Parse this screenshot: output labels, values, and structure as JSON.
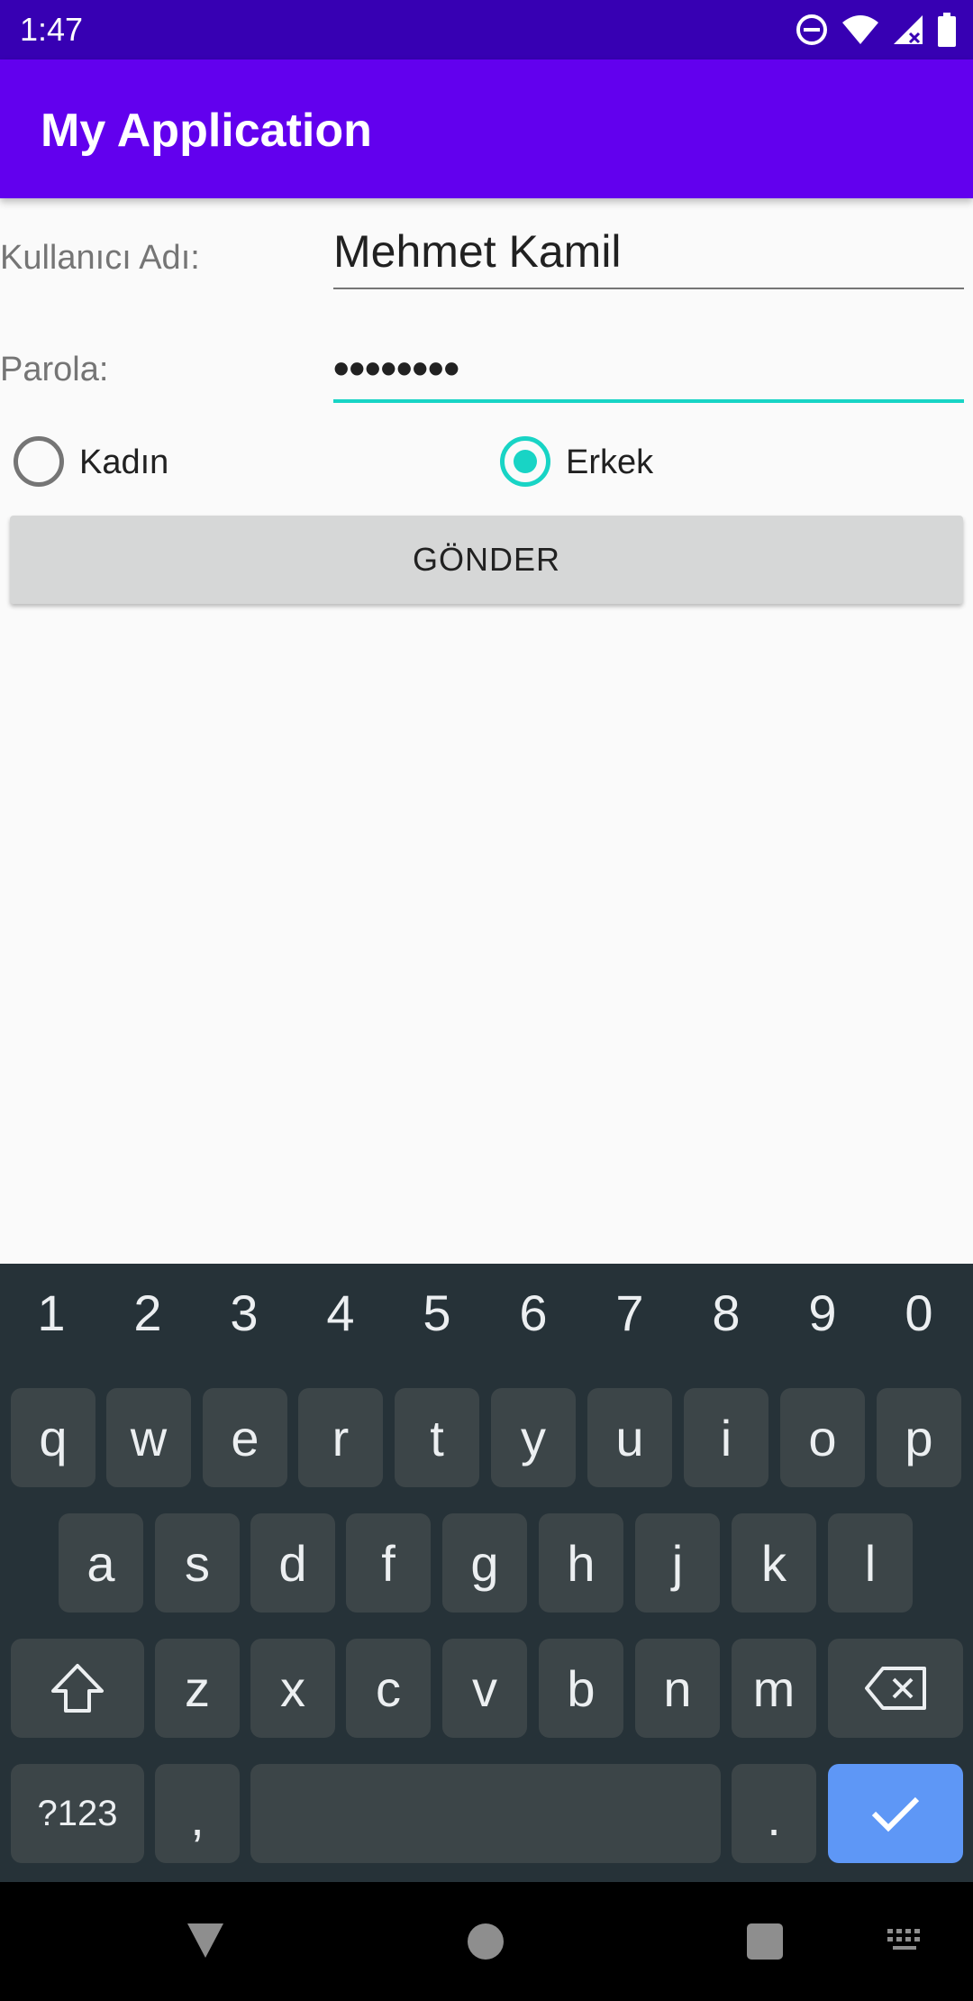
{
  "status_bar": {
    "time": "1:47",
    "icons": [
      "do-not-disturb-icon",
      "wifi-icon",
      "cellular-signal-icon",
      "battery-icon"
    ]
  },
  "app_bar": {
    "title": "My Application"
  },
  "form": {
    "username_label": "Kullanıcı Adı:",
    "username_value": "Mehmet Kamil",
    "password_label": "Parola:",
    "password_value": "••••••••",
    "gender_options": [
      {
        "label": "Kadın",
        "checked": false
      },
      {
        "label": "Erkek",
        "checked": true
      }
    ],
    "submit_label": "GÖNDER"
  },
  "keyboard": {
    "number_row": [
      "1",
      "2",
      "3",
      "4",
      "5",
      "6",
      "7",
      "8",
      "9",
      "0"
    ],
    "row1": [
      "q",
      "w",
      "e",
      "r",
      "t",
      "y",
      "u",
      "i",
      "o",
      "p"
    ],
    "row2": [
      "a",
      "s",
      "d",
      "f",
      "g",
      "h",
      "j",
      "k",
      "l"
    ],
    "row3": [
      "z",
      "x",
      "c",
      "v",
      "b",
      "n",
      "m"
    ],
    "symbols_label": "?123",
    "comma_label": ",",
    "period_label": "."
  },
  "nav_bar": {
    "icons": [
      "back-icon",
      "home-icon",
      "recents-icon",
      "keyboard-switch-icon"
    ]
  },
  "colors": {
    "status_bar": "#3700b3",
    "app_bar": "#6200ee",
    "accent": "#18d4c5",
    "keyboard_bg": "#263238",
    "key_bg": "#3c4548",
    "action_key": "#5e97f6"
  }
}
